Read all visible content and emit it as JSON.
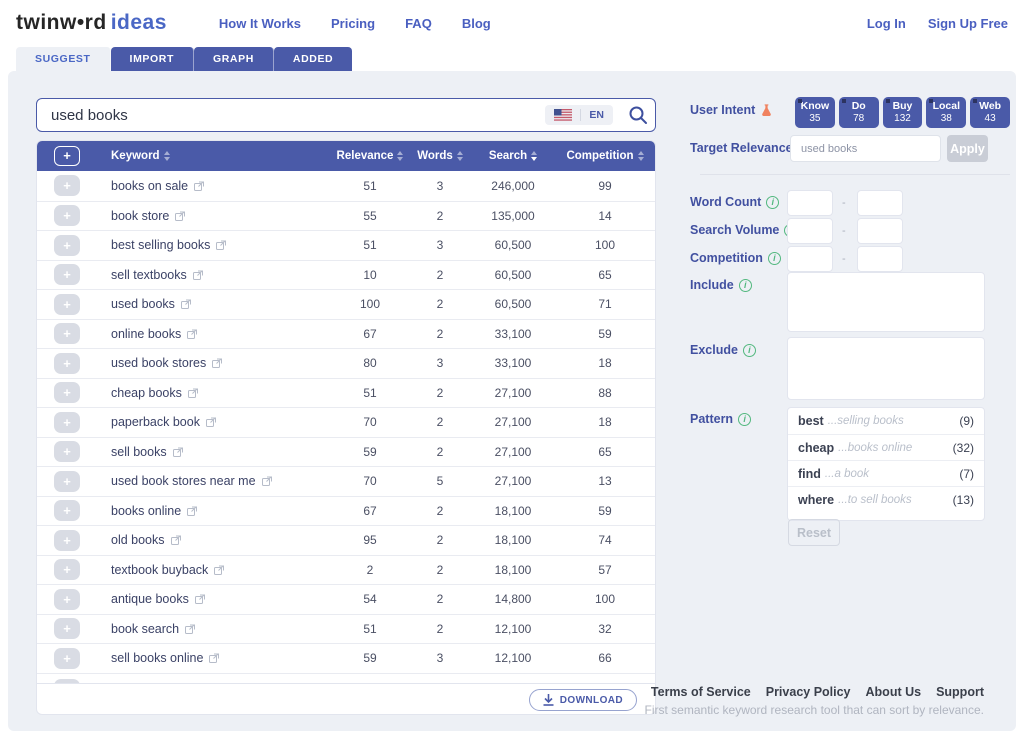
{
  "brand": {
    "name": "twinw•rd",
    "suffix": "ideas"
  },
  "nav": {
    "links": [
      {
        "label": "How It Works"
      },
      {
        "label": "Pricing"
      },
      {
        "label": "FAQ"
      },
      {
        "label": "Blog"
      }
    ],
    "login": "Log In",
    "signup": "Sign Up Free"
  },
  "tabs": [
    {
      "label": "SUGGEST",
      "active": true
    },
    {
      "label": "IMPORT",
      "active": false
    },
    {
      "label": "GRAPH",
      "active": false
    },
    {
      "label": "ADDED",
      "active": false
    }
  ],
  "search": {
    "value": "used books",
    "lang": "EN"
  },
  "table": {
    "columns": [
      "Keyword",
      "Relevance",
      "Words",
      "Search",
      "Competition"
    ],
    "sorted_by": "Search descending",
    "rows": [
      {
        "keyword": "books on sale",
        "relevance": "51",
        "words": "3",
        "search": "246,000",
        "competition": "99"
      },
      {
        "keyword": "book store",
        "relevance": "55",
        "words": "2",
        "search": "135,000",
        "competition": "14"
      },
      {
        "keyword": "best selling books",
        "relevance": "51",
        "words": "3",
        "search": "60,500",
        "competition": "100"
      },
      {
        "keyword": "sell textbooks",
        "relevance": "10",
        "words": "2",
        "search": "60,500",
        "competition": "65"
      },
      {
        "keyword": "used books",
        "relevance": "100",
        "words": "2",
        "search": "60,500",
        "competition": "71"
      },
      {
        "keyword": "online books",
        "relevance": "67",
        "words": "2",
        "search": "33,100",
        "competition": "59"
      },
      {
        "keyword": "used book stores",
        "relevance": "80",
        "words": "3",
        "search": "33,100",
        "competition": "18"
      },
      {
        "keyword": "cheap books",
        "relevance": "51",
        "words": "2",
        "search": "27,100",
        "competition": "88"
      },
      {
        "keyword": "paperback book",
        "relevance": "70",
        "words": "2",
        "search": "27,100",
        "competition": "18"
      },
      {
        "keyword": "sell books",
        "relevance": "59",
        "words": "2",
        "search": "27,100",
        "competition": "65"
      },
      {
        "keyword": "used book stores near me",
        "relevance": "70",
        "words": "5",
        "search": "27,100",
        "competition": "13"
      },
      {
        "keyword": "books online",
        "relevance": "67",
        "words": "2",
        "search": "18,100",
        "competition": "59"
      },
      {
        "keyword": "old books",
        "relevance": "95",
        "words": "2",
        "search": "18,100",
        "competition": "74"
      },
      {
        "keyword": "textbook buyback",
        "relevance": "2",
        "words": "2",
        "search": "18,100",
        "competition": "57"
      },
      {
        "keyword": "antique books",
        "relevance": "54",
        "words": "2",
        "search": "14,800",
        "competition": "100"
      },
      {
        "keyword": "book search",
        "relevance": "51",
        "words": "2",
        "search": "12,100",
        "competition": "32"
      },
      {
        "keyword": "sell books online",
        "relevance": "59",
        "words": "3",
        "search": "12,100",
        "competition": "66"
      }
    ],
    "download_label": "DOWNLOAD"
  },
  "intent": {
    "label": "User Intent",
    "buttons": [
      {
        "name": "Know",
        "count": "35"
      },
      {
        "name": "Do",
        "count": "78"
      },
      {
        "name": "Buy",
        "count": "132"
      },
      {
        "name": "Local",
        "count": "38"
      },
      {
        "name": "Web",
        "count": "43"
      }
    ]
  },
  "target_relevance": {
    "label": "Target Relevance",
    "value": "used books",
    "apply_label": "Apply"
  },
  "filters": {
    "word_count_label": "Word Count",
    "search_volume_label": "Search Volume",
    "competition_label": "Competition",
    "include_label": "Include",
    "exclude_label": "Exclude",
    "pattern_label": "Pattern",
    "patterns": [
      {
        "word": "best",
        "suffix": "...selling books",
        "count": "(9)"
      },
      {
        "word": "cheap",
        "suffix": "...books online",
        "count": "(32)"
      },
      {
        "word": "find",
        "suffix": "...a book",
        "count": "(7)"
      },
      {
        "word": "where",
        "suffix": "...to sell books",
        "count": "(13)"
      }
    ],
    "reset_label": "Reset"
  },
  "footer": {
    "links": [
      {
        "label": "Terms of Service"
      },
      {
        "label": "Privacy Policy"
      },
      {
        "label": "About Us"
      },
      {
        "label": "Support"
      }
    ],
    "tagline": "First semantic keyword research tool that can sort by relevance."
  },
  "colors": {
    "indigo": "#4a5aa8",
    "link_blue": "#4a67c5",
    "info_green": "#53b87f",
    "flask_orange": "#f0825f",
    "panel_bg": "#edf0f5"
  }
}
